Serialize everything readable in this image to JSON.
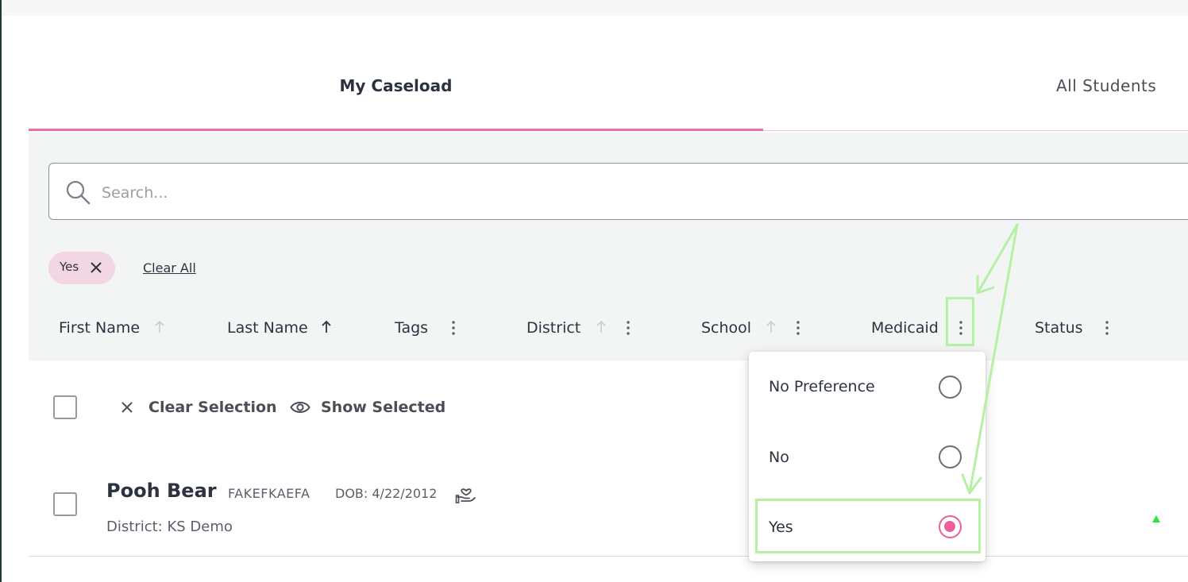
{
  "tabs": [
    {
      "label": "My Caseload",
      "active": true
    },
    {
      "label": "All Students",
      "active": false
    }
  ],
  "search": {
    "placeholder": "Search...",
    "value": ""
  },
  "filters": {
    "chips": [
      {
        "label": "Yes"
      }
    ],
    "clear_all_label": "Clear All"
  },
  "columns": [
    {
      "label": "First Name",
      "sort": "none"
    },
    {
      "label": "Last Name",
      "sort": "ascending"
    },
    {
      "label": "Tags"
    },
    {
      "label": "District",
      "sort": "none"
    },
    {
      "label": "School",
      "sort": "none"
    },
    {
      "label": "Medicaid"
    },
    {
      "label": "Status"
    }
  ],
  "selection": {
    "clear_selection_label": "Clear Selection",
    "show_selected_label": "Show Selected"
  },
  "students": [
    {
      "name": "Pooh Bear",
      "id": "FAKEFKAEFA",
      "dob": "DOB: 4/22/2012",
      "district_label": "District:",
      "district": "KS Demo",
      "icons": [
        "medicaid-hand-heart-icon"
      ]
    }
  ],
  "medicaid_menu": {
    "options": [
      {
        "label": "No Preference",
        "selected": false
      },
      {
        "label": "No",
        "selected": false
      },
      {
        "label": "Yes",
        "selected": true
      }
    ]
  },
  "colors": {
    "accent_pink": "#ee6fa6",
    "chip_bg": "#f3d6e3",
    "annotation_green": "#b5f0a3",
    "panel_bg": "#f3f4f4"
  }
}
